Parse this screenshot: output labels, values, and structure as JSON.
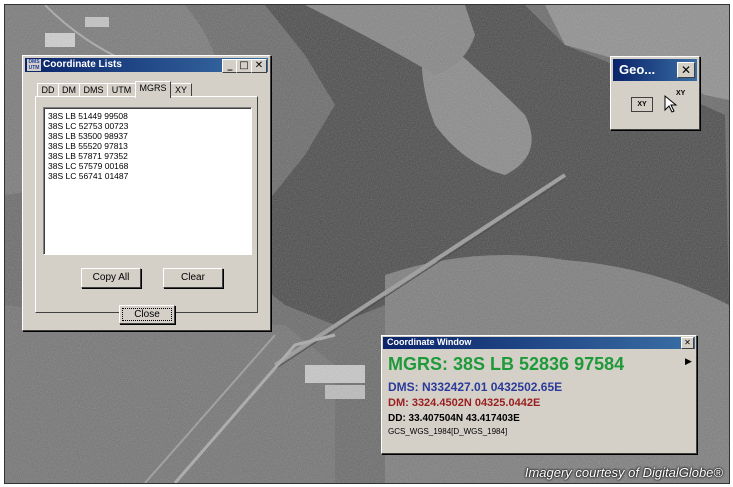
{
  "coordinate_lists": {
    "title": "Coordinate Lists",
    "icon_top": "DMS",
    "icon_bottom": "UTM",
    "min_glyph": "_",
    "max_glyph": "□",
    "close_glyph": "✕",
    "tabs": [
      "DD",
      "DM",
      "DMS",
      "UTM",
      "MGRS",
      "XY"
    ],
    "active_tab": "MGRS",
    "items": [
      "38S LB 51449 99508",
      "38S LC 52753 00723",
      "38S LB 53500 98937",
      "38S LB 55520 97813",
      "38S LB 57871 97352",
      "38S LC 57579 00168",
      "38S LC 56741 01487"
    ],
    "copy_all_label": "Copy All",
    "clear_label": "Clear",
    "close_label": "Close"
  },
  "geo_toolbar": {
    "title": "Geo...",
    "close_glyph": "✕",
    "xy_label": "XY"
  },
  "coordinate_window": {
    "title": "Coordinate Window",
    "close_glyph": "✕",
    "arrow_glyph": "▶",
    "mgrs": "MGRS: 38S LB 52836 97584",
    "dms": "DMS: N332427.01 0432502.65E",
    "dm": "DM: 3324.4502N 04325.0442E",
    "dd": "DD: 33.407504N 43.417403E",
    "datum": "GCS_WGS_1984[D_WGS_1984]",
    "colors": {
      "mgrs": "#1e9a3a",
      "dms": "#2b3a9a",
      "dm": "#9a1e1e",
      "dd": "#000000"
    }
  },
  "credit": "Imagery courtesy of DigitalGlobe®"
}
